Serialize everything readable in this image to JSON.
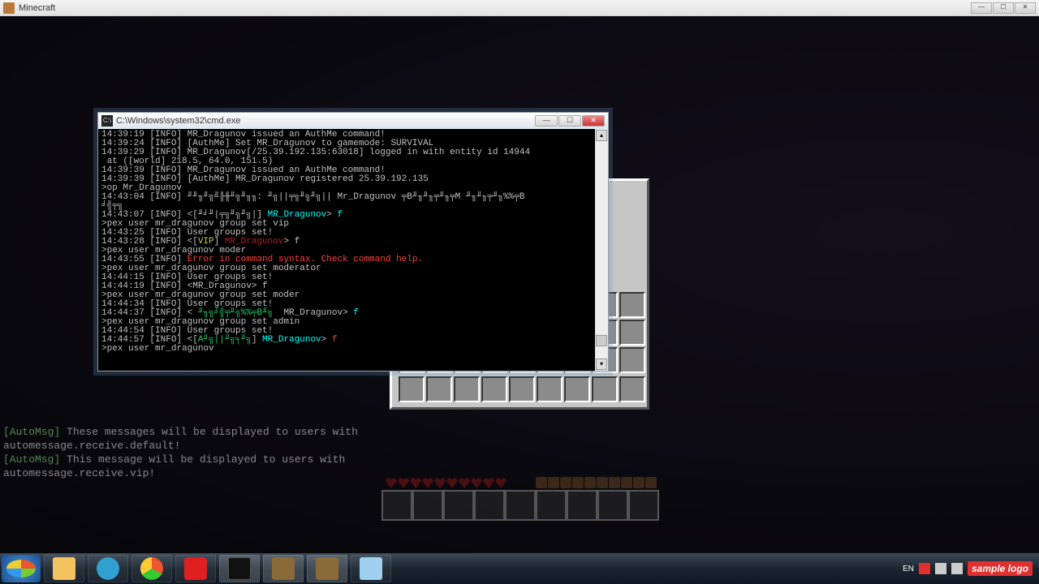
{
  "minecraft_window": {
    "title": "Minecraft"
  },
  "cmd_window": {
    "title": "C:\\Windows\\system32\\cmd.exe",
    "lines": [
      {
        "segs": [
          {
            "t": "14:39:19 [INFO] MR_Dragunov issued an AuthMe command!"
          }
        ]
      },
      {
        "segs": [
          {
            "t": "14:39:24 [INFO] [AuthMe] Set MR_Dragunov to gamemode: SURVIVAL"
          }
        ]
      },
      {
        "segs": [
          {
            "t": "14:39:29 [INFO] MR_Dragunov[/25.39.192.135:63018] logged in with entity id 14944"
          }
        ]
      },
      {
        "segs": [
          {
            "t": " at ([world] 218.5, 64.0, 151.5)"
          }
        ]
      },
      {
        "segs": [
          {
            "t": "14:39:39 [INFO] MR_Dragunov issued an AuthMe command!"
          }
        ]
      },
      {
        "segs": [
          {
            "t": "14:39:39 [INFO] [AuthMe] MR_Dragunov registered 25.39.192.135"
          }
        ]
      },
      {
        "segs": [
          {
            "t": ">op Mr_Dragunov"
          }
        ]
      },
      {
        "segs": [
          {
            "t": "14:43:04 [INFO] ╜╜╖╜╗╝╟╫╜╗╜╖╖: ╜╗||╤╗╜╗╜╗|| Mr_Dragunov ╤B╜╖╜╖╤╜╖╤M ╜╖╜╖╤╜╖%%╤B"
          }
        ]
      },
      {
        "segs": [
          {
            "t": "╛╣╤╗"
          }
        ]
      },
      {
        "segs": [
          {
            "t": "14:43:07 [INFO] <[╜╛╜|╤╗╜╗╜╗|] "
          },
          {
            "t": "MR_Dragunov",
            "c": "c-cyan"
          },
          {
            "t": "> "
          },
          {
            "t": "f",
            "c": "c-cyan"
          }
        ]
      },
      {
        "segs": [
          {
            "t": ">pex user mr_dragunov group set vip"
          }
        ]
      },
      {
        "segs": [
          {
            "t": "14:43:25 [INFO] User groups set!"
          }
        ]
      },
      {
        "segs": [
          {
            "t": "14:43:28 [INFO] <["
          },
          {
            "t": "VIP",
            "c": "c-yellow"
          },
          {
            "t": "] "
          },
          {
            "t": "MR_Dragunov",
            "c": "c-darkred"
          },
          {
            "t": "> f"
          }
        ]
      },
      {
        "segs": [
          {
            "t": ">pex user mr_dragunov moder"
          }
        ]
      },
      {
        "segs": [
          {
            "t": "14:43:55 [INFO] "
          },
          {
            "t": "Error in command syntax. Check command help.",
            "c": "c-red"
          }
        ]
      },
      {
        "segs": [
          {
            "t": ">pex user mr_dragunov group set moderator"
          }
        ]
      },
      {
        "segs": [
          {
            "t": "14:44:15 [INFO] User groups set!"
          }
        ]
      },
      {
        "segs": [
          {
            "t": "14:44:19 [INFO] <MR_Dragunov> f"
          }
        ]
      },
      {
        "segs": [
          {
            "t": ">pex user mr_dragunov group set moder"
          }
        ]
      },
      {
        "segs": [
          {
            "t": "14:44:34 [INFO] User groups set!"
          }
        ]
      },
      {
        "segs": [
          {
            "t": "14:44:37 [INFO] < "
          },
          {
            "t": "╜╖╗╛╣╤╜╗%%╤B╜╗",
            "c": "c-green"
          },
          {
            "t": "  MR_Dragunov> "
          },
          {
            "t": "f",
            "c": "c-cyan"
          }
        ]
      },
      {
        "segs": [
          {
            "t": ">pex user mr_dragunov group set admin"
          }
        ]
      },
      {
        "segs": [
          {
            "t": "14:44:54 [INFO] User groups set!"
          }
        ]
      },
      {
        "segs": [
          {
            "t": "14:44:57 [INFO] <["
          },
          {
            "t": "A╜╗||╜╗╕╜╗",
            "c": "c-green"
          },
          {
            "t": "] "
          },
          {
            "t": "MR_Dragunov",
            "c": "c-cyan"
          },
          {
            "t": "> "
          },
          {
            "t": "f",
            "c": "c-red"
          }
        ]
      },
      {
        "segs": [
          {
            "t": ">pex user mr_dragunov"
          }
        ]
      }
    ]
  },
  "chat": {
    "tag": "[AutoMsg]",
    "line1": " These messages will be displayed to users with",
    "line2": "automessage.receive.default!",
    "line3": " This message will be displayed to users with",
    "line4": "automessage.receive.vip!"
  },
  "taskbar": {
    "lang": "EN",
    "items": [
      "explorer",
      "media",
      "chrome",
      "opera",
      "cmd",
      "minecraft1",
      "minecraft2",
      "notes"
    ]
  },
  "tray": {
    "sample_logo": "sample logo"
  },
  "colors": {
    "chrome_ring": "conic-gradient(#e53 0 33%, #3c3 33% 66%, #fc3 66% 100%)",
    "opera": "#e02020",
    "explorer": "#f5c260",
    "media": "#30a0d0",
    "cmd": "#111",
    "mc": "#8b6a3a",
    "notes": "#a0d0f0"
  }
}
